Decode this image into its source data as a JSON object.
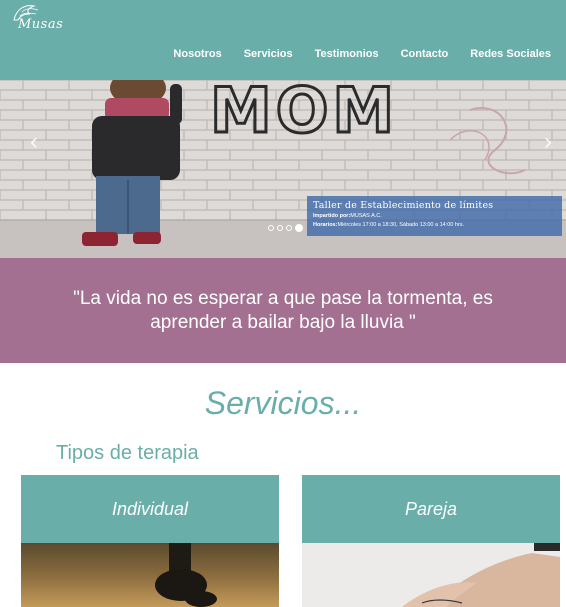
{
  "logo": {
    "text": "Musas"
  },
  "nav": [
    "Nosotros",
    "Servicios",
    "Testimonios",
    "Contacto",
    "Redes Sociales"
  ],
  "carousel": {
    "graffiti": "MOM",
    "caption_title": "Taller de Establecimiento de límites",
    "caption_line1_label": "Impartido por:",
    "caption_line1_value": "MUSAS A.C.",
    "caption_line2_label": "Horarios:",
    "caption_line2_value": "Miércoles 17:00 a 18:30, Sábado 13:00 a 14:00 hrs.",
    "prev_icon": "‹",
    "next_icon": "›",
    "slide_count": 4,
    "active_slide": 4
  },
  "quote": "\"La vida no es esperar a que pase la tormenta, es aprender a bailar bajo la lluvia \"",
  "services": {
    "title": "Servicios...",
    "subtitle": "Tipos de terapia",
    "cards": [
      {
        "label": "Individual"
      },
      {
        "label": "Pareja"
      }
    ]
  },
  "colors": {
    "teal": "#6aaeaa",
    "mauve": "#a47092",
    "caption_blue": "#466eaa"
  }
}
